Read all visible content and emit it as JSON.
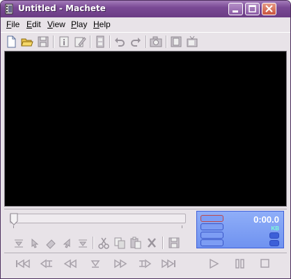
{
  "window": {
    "title": "Untitled - Machete",
    "controls": [
      "minimize",
      "maximize",
      "close"
    ],
    "colors": {
      "titlebar": "#7A4A95",
      "lcd": "#7F9FF4",
      "lcd_time_text": "#FFFFFF",
      "lcd_unit_text": "#7DFFD8"
    }
  },
  "menu": {
    "items": [
      {
        "label": "File",
        "mnemonic": "F",
        "rest": "ile"
      },
      {
        "label": "Edit",
        "mnemonic": "E",
        "rest": "dit"
      },
      {
        "label": "View",
        "mnemonic": "V",
        "rest": "iew"
      },
      {
        "label": "Play",
        "mnemonic": "P",
        "rest": "lay"
      },
      {
        "label": "Help",
        "mnemonic": "H",
        "rest": "elp"
      }
    ]
  },
  "toolbar": {
    "icons": [
      "new-file-icon",
      "open-folder-icon",
      "save-icon",
      "info-icon",
      "edit-tags-icon",
      "film-icon",
      "undo-icon",
      "redo-icon",
      "snapshot-icon",
      "film-frames-icon",
      "tv-icon"
    ]
  },
  "editbar": {
    "icons": [
      "mark-in-icon",
      "select-start-icon",
      "eraser-icon",
      "select-end-icon",
      "mark-out-icon",
      "cut-icon",
      "copy-icon",
      "paste-icon",
      "delete-icon",
      "save-selection-icon"
    ]
  },
  "status": {
    "time": "0:00.0",
    "unit": "KB"
  },
  "transport": {
    "icons": [
      "go-start-icon",
      "prev-mark-icon",
      "rewind-icon",
      "mark-down-icon",
      "fast-forward-icon",
      "next-mark-icon",
      "go-end-icon",
      "play-icon",
      "pause-icon",
      "stop-icon"
    ]
  }
}
